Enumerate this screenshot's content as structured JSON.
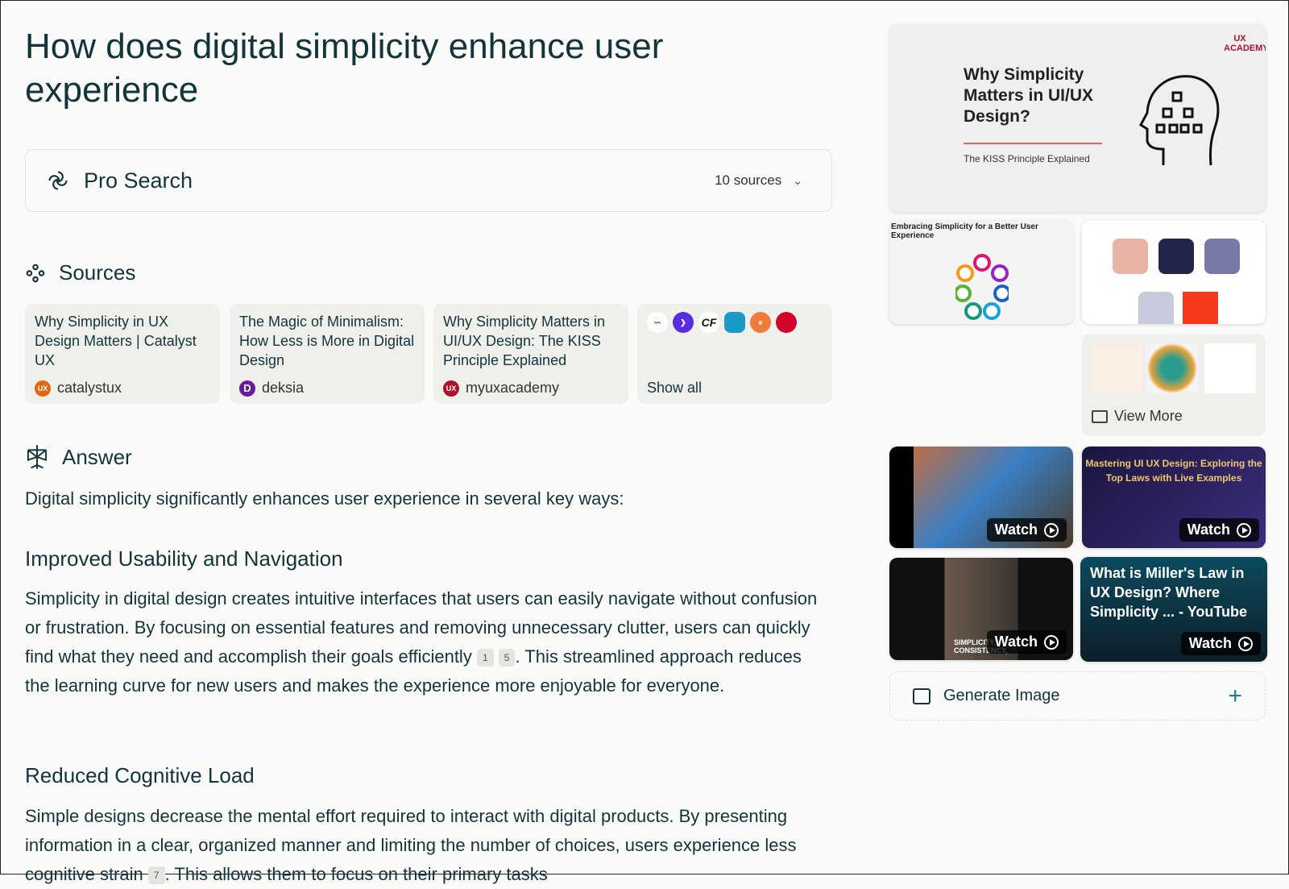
{
  "title": "How does digital simplicity enhance user experience",
  "pro_search": {
    "label": "Pro Search",
    "sources_count": "10 sources"
  },
  "sources": {
    "heading": "Sources",
    "items": [
      {
        "title": "Why Simplicity in UX Design Matters | Catalyst UX",
        "site": "catalystux",
        "color": "#e8650f"
      },
      {
        "title": "The Magic of Minimalism: How Less is More in Digital Design",
        "site": "deksia",
        "color": "#6a1b9a"
      },
      {
        "title": "Why Simplicity Matters in UI/UX Design: The KISS Principle Explained",
        "site": "myuxacademy",
        "color": "#b0102b"
      }
    ],
    "show_all": "Show all"
  },
  "answer": {
    "heading": "Answer",
    "intro": "Digital simplicity significantly enhances user experience in several key ways:",
    "sections": [
      {
        "heading": "Improved Usability and Navigation",
        "text_a": "Simplicity in digital design creates intuitive interfaces that users can easily navigate without confusion or frustration. By focusing on essential features and removing unnecessary clutter, users can quickly find what they need and accomplish their goals efficiently",
        "cites": [
          "1",
          "5"
        ],
        "text_b": ". This streamlined approach reduces the learning curve for new users and makes the experience more enjoyable for everyone."
      },
      {
        "heading": "Reduced Cognitive Load",
        "text_a": "Simple designs decrease the mental effort required to interact with digital products. By presenting information in a clear, organized manner and limiting the number of choices, users experience less cognitive strain",
        "cites": [
          "7"
        ],
        "text_b": ". This allows them to focus on their primary tasks"
      }
    ]
  },
  "media": {
    "main_image": {
      "title": "Why Simplicity Matters in UI/UX Design?",
      "subtitle": "The KISS Principle Explained",
      "logo": "UX ACADEMY"
    },
    "image2_title": "Embracing Simplicity for a Better User Experience",
    "view_more": "View More",
    "videos": [
      {
        "overlay": ""
      },
      {
        "overlay": "Mastering UI UX Design: Exploring the Top Laws with Live Examples"
      },
      {
        "overlay": "SIMPLICITY, CONSISTENCY,"
      },
      {
        "overlay": "What is Miller's Law in UX Design? Where Simplicity ... - YouTube"
      }
    ],
    "watch_label": "Watch",
    "generate_image": "Generate Image"
  }
}
